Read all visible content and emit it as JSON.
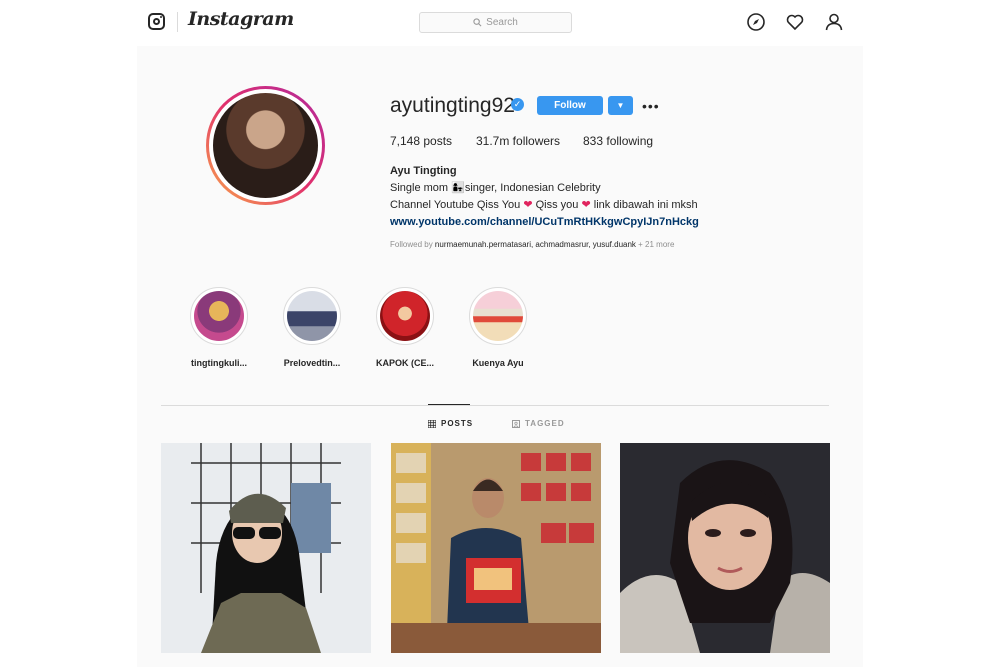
{
  "header": {
    "wordmark": "Instagram",
    "search_placeholder": "Search",
    "nav_icons": [
      "compass-icon",
      "heart-icon",
      "profile-icon"
    ]
  },
  "profile": {
    "username": "ayutingting92",
    "verified": true,
    "follow_label": "Follow",
    "stats": {
      "posts": "7,148 posts",
      "followers": "31.7m followers",
      "following": "833 following"
    },
    "bio": {
      "name": "Ayu Tingting",
      "line1": "Single mom 👩‍👧singer, Indonesian Celebrity",
      "line2a": "Channel Youtube Qiss You ",
      "line2b": " Qiss you ",
      "line2c": " link dibawah ini mksh",
      "link": "www.youtube.com/channel/UCuTmRtHKkgwCpyIJn7nHckg"
    },
    "followed_by": {
      "prefix": "Followed by ",
      "names": "nurmaemunah.permatasari, achmadmasrur, yusuf.duank",
      "suffix": " + 21 more"
    }
  },
  "highlights": [
    {
      "label": "tingtingkuli..."
    },
    {
      "label": "Prelovedtin..."
    },
    {
      "label": "KAPOK (CE..."
    },
    {
      "label": "Kuenya Ayu"
    }
  ],
  "tabs": [
    {
      "label": "POSTS",
      "active": true
    },
    {
      "label": "TAGGED",
      "active": false
    }
  ],
  "colors": {
    "accent": "#3897f0",
    "link": "#003569",
    "page_bg": "#fafafa",
    "border": "#dbdbdb"
  }
}
